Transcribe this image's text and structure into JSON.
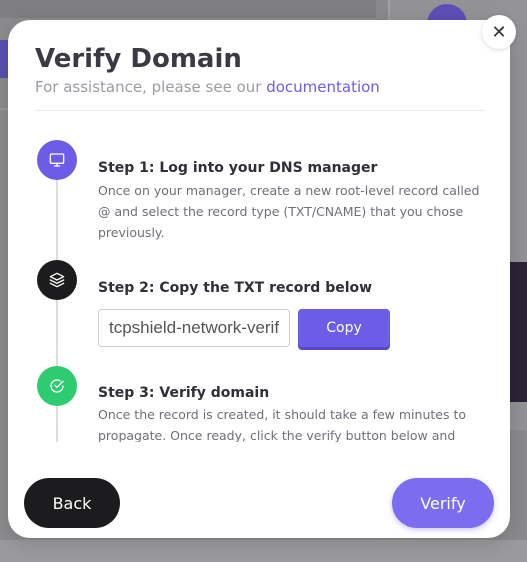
{
  "modal": {
    "title": "Verify Domain",
    "subtitle_prefix": "For assistance, please see our",
    "subtitle_link": "documentation",
    "close_glyph": "✕"
  },
  "steps": [
    {
      "title": "Step 1: Log into your DNS manager",
      "description": "Once on your manager, create a new root-level record called @ and select the record type (TXT/CNAME) that you chose previously.",
      "icon": "monitor-icon",
      "color": "#6c5ce7"
    },
    {
      "title": "Step 2: Copy the TXT record below",
      "record_value": "tcpshield-network-verification",
      "copy_label": "Copy",
      "icon": "layers-icon",
      "color": "#1c1c1e"
    },
    {
      "title": "Step 3: Verify domain",
      "description": "Once the record is created, it should take a few minutes to propagate. Once ready, click the verify button below and your domain will be added!",
      "icon": "check-circle-icon",
      "color": "#2ecc71"
    }
  ],
  "footer": {
    "back_label": "Back",
    "verify_label": "Verify"
  },
  "colors": {
    "accent": "#6c5ce7",
    "success": "#2ecc71",
    "dark": "#1c1c1e"
  }
}
